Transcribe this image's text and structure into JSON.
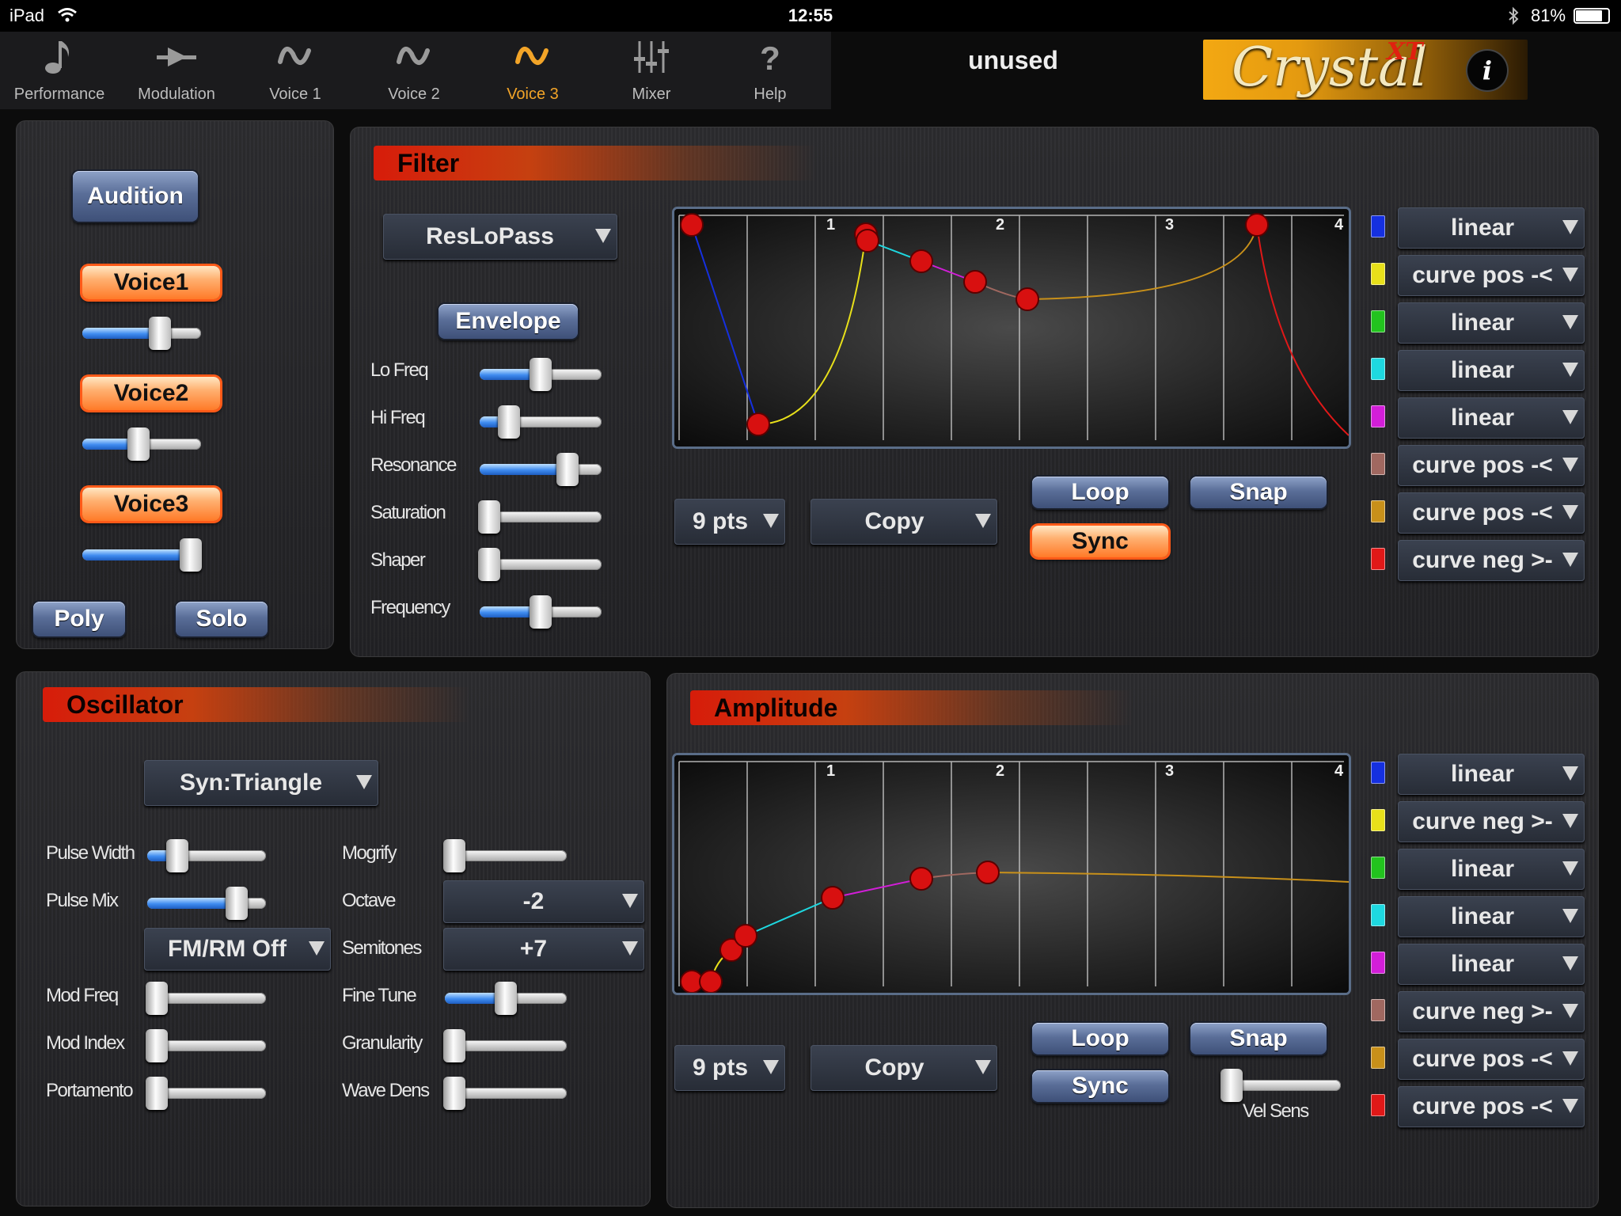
{
  "status_bar": {
    "device": "iPad",
    "time": "12:55",
    "battery": "81%"
  },
  "tabs": [
    {
      "label": "Performance",
      "icon": "music-note-icon"
    },
    {
      "label": "Modulation",
      "icon": "modulation-icon"
    },
    {
      "label": "Voice 1",
      "icon": "wave-icon"
    },
    {
      "label": "Voice 2",
      "icon": "wave-icon"
    },
    {
      "label": "Voice 3",
      "icon": "wave-icon",
      "active": true
    },
    {
      "label": "Mixer",
      "icon": "mixer-icon"
    },
    {
      "label": "Help",
      "icon": "help-icon"
    }
  ],
  "preset_name": "unused",
  "logo": {
    "text": "Crystal",
    "suffix": "XT"
  },
  "voice_panel": {
    "audition": "Audition",
    "voices": [
      {
        "label": "Voice1",
        "level": 0.65
      },
      {
        "label": "Voice2",
        "level": 0.47
      },
      {
        "label": "Voice3",
        "level": 0.91
      }
    ],
    "poly": "Poly",
    "solo": "Solo"
  },
  "filter": {
    "title": "Filter",
    "type": "ResLoPass",
    "envelope": "Envelope",
    "params": [
      {
        "label": "Lo Freq",
        "value": 0.5
      },
      {
        "label": "Hi Freq",
        "value": 0.24
      },
      {
        "label": "Resonance",
        "value": 0.72
      },
      {
        "label": "Saturation",
        "value": 0.08
      },
      {
        "label": "Shaper",
        "value": 0.08
      },
      {
        "label": "Frequency",
        "value": 0.5
      }
    ],
    "graph": {
      "markers": [
        "1",
        "2",
        "3",
        "4"
      ]
    },
    "pts": "9 pts",
    "copy": "Copy",
    "loop": "Loop",
    "snap": "Snap",
    "sync": "Sync",
    "curves": [
      {
        "label": "linear",
        "color": "#1530e0"
      },
      {
        "label": "curve pos -<",
        "color": "#e8e01a"
      },
      {
        "label": "linear",
        "color": "#22c31e"
      },
      {
        "label": "linear",
        "color": "#1ed8e0"
      },
      {
        "label": "linear",
        "color": "#d21ed8"
      },
      {
        "label": "curve pos -<",
        "color": "#a06860"
      },
      {
        "label": "curve pos -<",
        "color": "#c8901a"
      },
      {
        "label": "curve neg >-",
        "color": "#e01818"
      }
    ]
  },
  "oscillator": {
    "title": "Oscillator",
    "wave": "Syn:Triangle",
    "left_params": [
      {
        "label": "Pulse Width",
        "value": 0.25
      },
      {
        "label": "Pulse Mix",
        "value": 0.75
      }
    ],
    "fmrm": "FM/RM Off",
    "left_params2": [
      {
        "label": "Mod Freq",
        "value": 0.08
      },
      {
        "label": "Mod Index",
        "value": 0.08
      },
      {
        "label": "Portamento",
        "value": 0.08
      }
    ],
    "mogrify": {
      "label": "Mogrify",
      "value": 0.08
    },
    "octave": {
      "label": "Octave",
      "value": "-2"
    },
    "semitones": {
      "label": "Semitones",
      "value": "+7"
    },
    "right_params": [
      {
        "label": "Fine Tune",
        "value": 0.5
      },
      {
        "label": "Granularity",
        "value": 0.08
      },
      {
        "label": "Wave Dens",
        "value": 0.08
      }
    ]
  },
  "amplitude": {
    "title": "Amplitude",
    "graph": {
      "markers": [
        "1",
        "2",
        "3",
        "4"
      ]
    },
    "pts": "9 pts",
    "copy": "Copy",
    "loop": "Loop",
    "snap": "Snap",
    "sync": "Sync",
    "vel_sens": {
      "label": "Vel Sens",
      "value": 0.08
    },
    "curves": [
      {
        "label": "linear",
        "color": "#1530e0"
      },
      {
        "label": "curve neg >-",
        "color": "#e8e01a"
      },
      {
        "label": "linear",
        "color": "#22c31e"
      },
      {
        "label": "linear",
        "color": "#1ed8e0"
      },
      {
        "label": "linear",
        "color": "#d21ed8"
      },
      {
        "label": "curve neg >-",
        "color": "#a06860"
      },
      {
        "label": "curve pos -<",
        "color": "#c8901a"
      },
      {
        "label": "curve pos -<",
        "color": "#e01818"
      }
    ]
  }
}
